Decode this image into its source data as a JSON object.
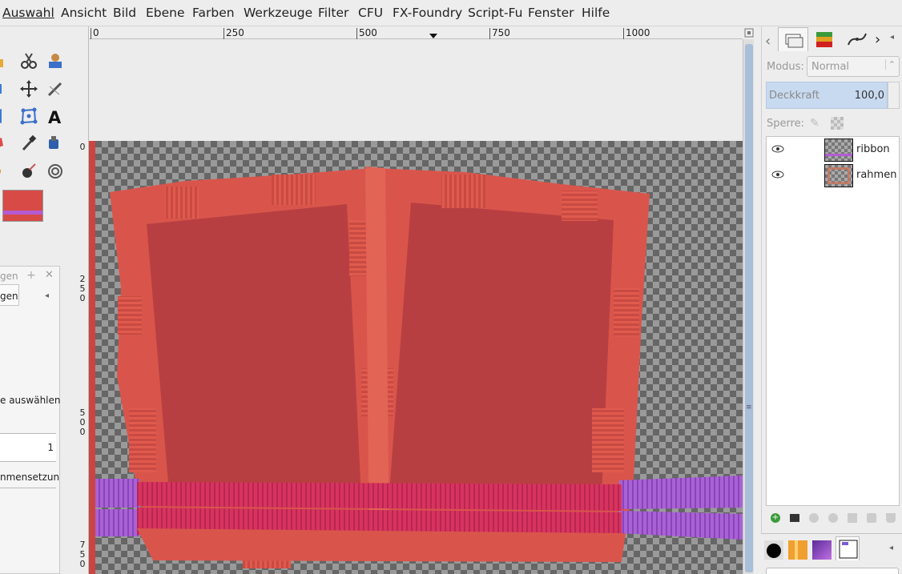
{
  "menu": {
    "items": [
      "Auswahl",
      "Ansicht",
      "Bild",
      "Ebene",
      "Farben",
      "Werkzeuge",
      "Filter",
      "CFU",
      "FX-Foundry",
      "Script-Fu",
      "Fenster",
      "Hilfe"
    ]
  },
  "ruler": {
    "h_labels": [
      "0",
      "250",
      "500",
      "750",
      "1000"
    ],
    "v_labels": [
      "0",
      "250",
      "500",
      "750"
    ]
  },
  "dock": {
    "title_fragment": "gen",
    "tab_fragment": "gen",
    "select_text": "e auswählen",
    "value": "1",
    "compose_text": "nmensetzun"
  },
  "layers_panel": {
    "mode_label": "Modus:",
    "mode_value": "Normal",
    "opacity_label": "Deckkraft",
    "opacity_value": "100,0",
    "lock_label": "Sperre:",
    "layers": [
      {
        "name": "ribbon",
        "visible": true
      },
      {
        "name": "rahmen",
        "visible": true
      }
    ]
  },
  "colors": {
    "frame": "#d9554c",
    "photo_area": "#b83f42",
    "ribbon_pink": "#d63462",
    "ribbon_purple": "#a35ed2"
  }
}
